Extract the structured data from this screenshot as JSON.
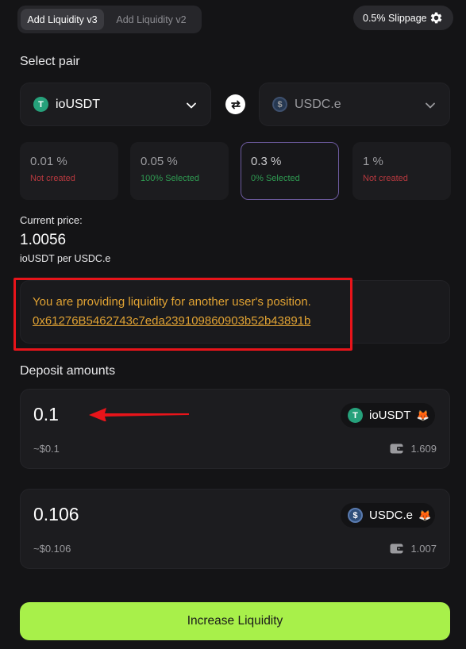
{
  "tabs": {
    "v3_label": "Add Liquidity v3",
    "v2_label": "Add Liquidity v2"
  },
  "slippage": {
    "label": "0.5% Slippage",
    "icon": "gear-icon"
  },
  "select_pair": {
    "title": "Select pair",
    "token_a": "ioUSDT",
    "token_b": "USDC.e"
  },
  "fee_tiers": [
    {
      "pct": "0.01 %",
      "status": "Not created",
      "status_color": "#b8393f"
    },
    {
      "pct": "0.05 %",
      "status": "100% Selected",
      "status_color": "#2f9b52"
    },
    {
      "pct": "0.3 %",
      "status": "0% Selected",
      "status_color": "#2f9b52",
      "selected": true
    },
    {
      "pct": "1 %",
      "status": "Not created",
      "status_color": "#b8393f"
    }
  ],
  "current_price": {
    "label": "Current price:",
    "value": "1.0056",
    "unit": "ioUSDT per USDC.e"
  },
  "notice": {
    "text": "You are providing liquidity for another user's position.",
    "address": "0x61276B5462743c7eda239109860903b52b43891b",
    "color": "#e0a233"
  },
  "deposit": {
    "title": "Deposit amounts",
    "token_a": {
      "amount": "0.1",
      "usd": "~$0.1",
      "symbol": "ioUSDT",
      "balance": "1.609"
    },
    "token_b": {
      "amount": "0.106",
      "usd": "~$0.106",
      "symbol": "USDC.e",
      "balance": "1.007"
    }
  },
  "primary_button": {
    "label": "Increase Liquidity",
    "color": "#a8f04a"
  },
  "annotation": {
    "highlight_color": "#e8141a",
    "arrow_color": "#e8141a"
  }
}
